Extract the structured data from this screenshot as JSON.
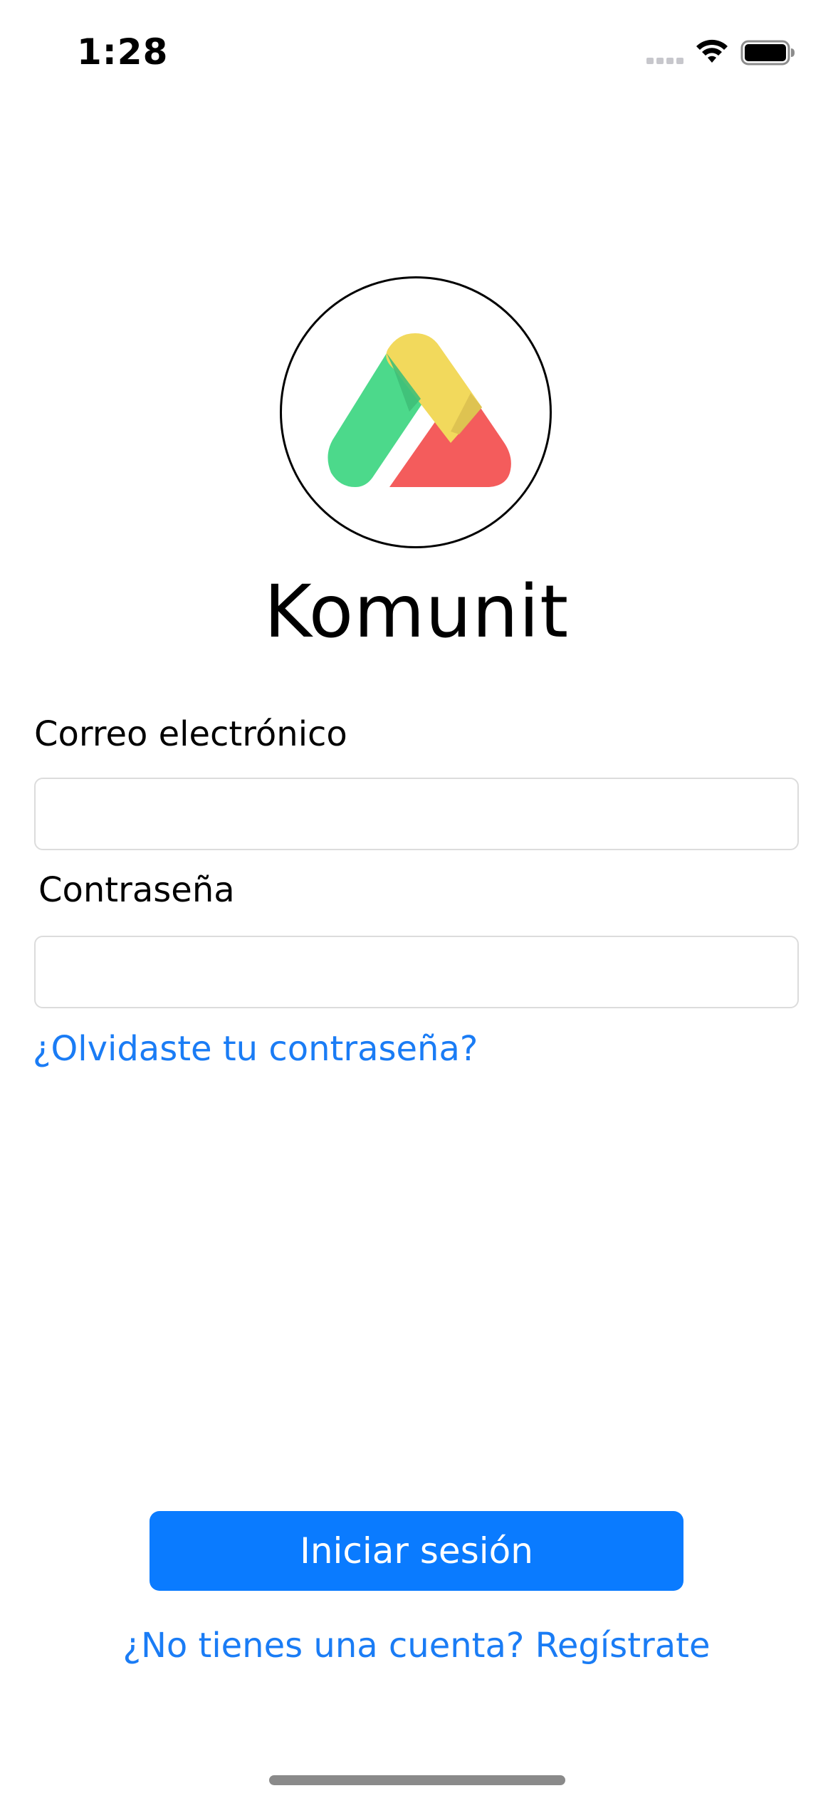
{
  "status_bar": {
    "time": "1:28"
  },
  "app": {
    "name": "Komunit"
  },
  "form": {
    "email_label": "Correo electrónico",
    "email_value": "",
    "password_label": "Contraseña",
    "password_value": "",
    "forgot_password": "¿Olvidaste tu contraseña?"
  },
  "actions": {
    "login_label": "Iniciar sesión",
    "signup_text": "¿No tienes una cuenta? Regístrate"
  },
  "colors": {
    "accent": "#0a7bff",
    "link": "#1a7cf5",
    "logo_green": "#4cd98b",
    "logo_yellow": "#f2d95c",
    "logo_red": "#f45c5c"
  },
  "icons": {
    "signal": "cellular-signal-icon",
    "wifi": "wifi-icon",
    "battery": "battery-icon"
  }
}
